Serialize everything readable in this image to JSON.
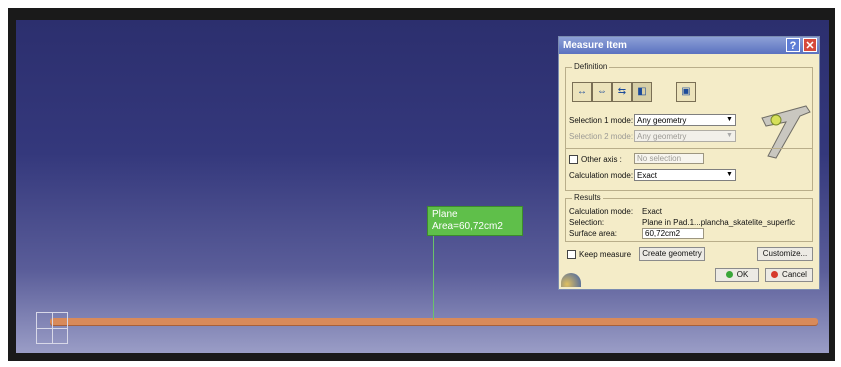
{
  "viewport": {
    "annotation": {
      "line1": "Plane",
      "line2": "Area=60,72cm2"
    }
  },
  "dialog": {
    "title": "Measure Item",
    "help_label": "?",
    "close_label": "✕",
    "definition": {
      "group_label": "Definition",
      "selection1_label": "Selection 1 mode:",
      "selection1_value": "Any geometry",
      "selection2_label": "Selection 2 mode:",
      "selection2_value": "Any geometry",
      "other_axis_label": "Other axis :",
      "other_axis_value": "No selection",
      "calc_mode_label": "Calculation mode:",
      "calc_mode_value": "Exact"
    },
    "results": {
      "group_label": "Results",
      "calc_mode_label": "Calculation mode:",
      "calc_mode_value": "Exact",
      "selection_label": "Selection:",
      "selection_value": "Plane in Pad.1...plancha_skatelite_superfic",
      "area_label": "Surface area:",
      "area_value": "60,72cm2"
    },
    "keep_measure_label": "Keep measure",
    "create_geometry_label": "Create geometry",
    "customize_label": "Customize...",
    "ok_label": "OK",
    "cancel_label": "Cancel"
  }
}
